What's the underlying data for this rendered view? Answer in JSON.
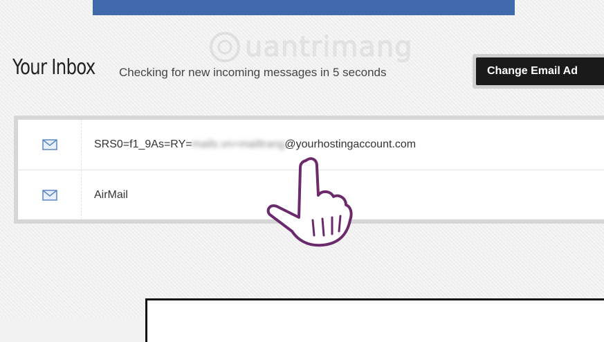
{
  "watermark": {
    "text": "uantrimang"
  },
  "header": {
    "title": "Your Inbox",
    "status": "Checking for new incoming messages in 5 seconds",
    "change_button": "Change Email Ad"
  },
  "messages": [
    {
      "sender_prefix": "SRS0=f1_9As=RY=",
      "sender_blurred": "mails.vn=mailtrang",
      "sender_suffix": "@yourhostingaccount.com",
      "icon": "envelope-icon"
    },
    {
      "sender_prefix": "AirMail",
      "sender_blurred": "",
      "sender_suffix": "",
      "icon": "envelope-icon"
    }
  ],
  "pointer": {
    "icon": "hand-pointer-icon"
  }
}
